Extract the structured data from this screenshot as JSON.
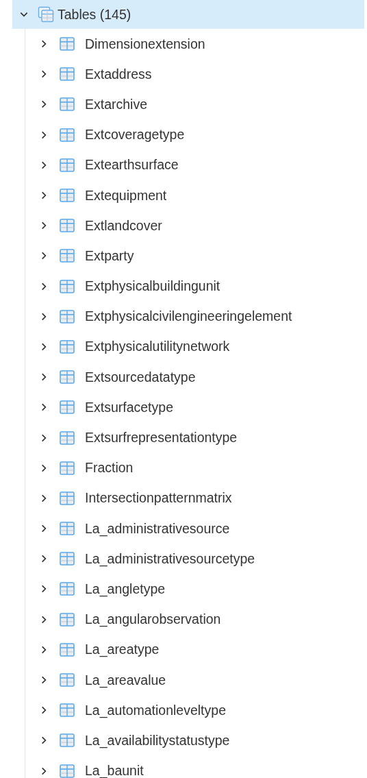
{
  "tree": {
    "label": "Tables (145)",
    "expanded": true,
    "selected": true,
    "children": [
      {
        "label": "Dimensionextension",
        "expanded": false
      },
      {
        "label": "Extaddress",
        "expanded": false
      },
      {
        "label": "Extarchive",
        "expanded": false
      },
      {
        "label": "Extcoveragetype",
        "expanded": false
      },
      {
        "label": "Extearthsurface",
        "expanded": false
      },
      {
        "label": "Extequipment",
        "expanded": false
      },
      {
        "label": "Extlandcover",
        "expanded": false
      },
      {
        "label": "Extparty",
        "expanded": false
      },
      {
        "label": "Extphysicalbuildingunit",
        "expanded": false
      },
      {
        "label": "Extphysicalcivilengineeringelement",
        "expanded": false
      },
      {
        "label": "Extphysicalutilitynetwork",
        "expanded": false
      },
      {
        "label": "Extsourcedatatype",
        "expanded": false
      },
      {
        "label": "Extsurfacetype",
        "expanded": false
      },
      {
        "label": "Extsurfrepresentationtype",
        "expanded": false
      },
      {
        "label": "Fraction",
        "expanded": false
      },
      {
        "label": "Intersectionpatternmatrix",
        "expanded": false
      },
      {
        "label": "La_administrativesource",
        "expanded": false
      },
      {
        "label": "La_administrativesourcetype",
        "expanded": false
      },
      {
        "label": "La_angletype",
        "expanded": false
      },
      {
        "label": "La_angularobservation",
        "expanded": false
      },
      {
        "label": "La_areatype",
        "expanded": false
      },
      {
        "label": "La_areavalue",
        "expanded": false
      },
      {
        "label": "La_automationleveltype",
        "expanded": false
      },
      {
        "label": "La_availabilitystatustype",
        "expanded": false
      },
      {
        "label": "La_baunit",
        "expanded": false
      }
    ]
  }
}
